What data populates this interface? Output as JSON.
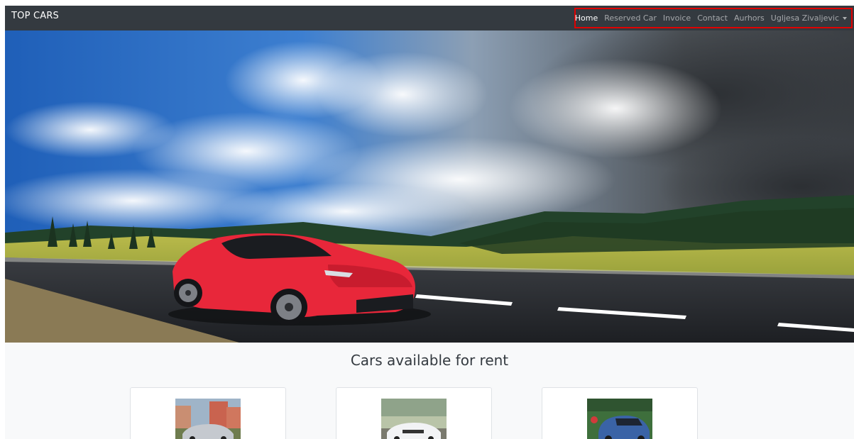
{
  "navbar": {
    "brand": "TOP CARS",
    "links": [
      {
        "label": "Home",
        "active": true
      },
      {
        "label": "Reserved Car",
        "active": false
      },
      {
        "label": "Invoice",
        "active": false
      },
      {
        "label": "Contact",
        "active": false
      },
      {
        "label": "Aurhors",
        "active": false
      }
    ],
    "user_menu": {
      "label": "Ugljesa Zivaljevic"
    }
  },
  "hero": {
    "image": "red-sports-car-on-mountain-road"
  },
  "main": {
    "title": "Cars available for rent",
    "cards": [
      {
        "image": "silver-sedan-photo"
      },
      {
        "image": "white-convertible-photo"
      },
      {
        "image": "blue-suv-photo"
      }
    ]
  },
  "colors": {
    "navbar": "#343a40",
    "highlight": "#e00000",
    "content_bg": "#f8f9fa"
  }
}
